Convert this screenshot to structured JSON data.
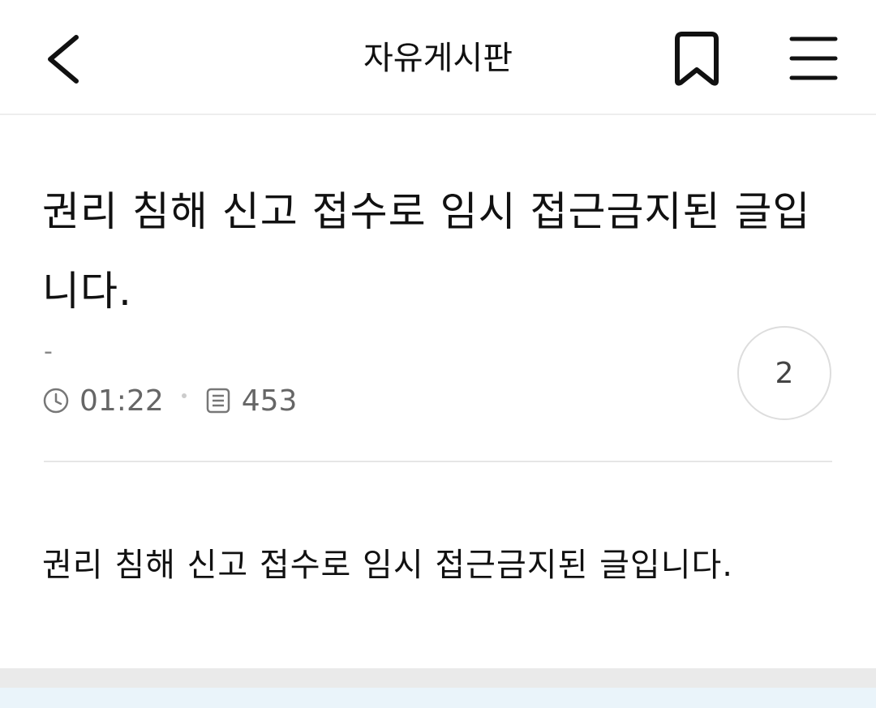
{
  "header": {
    "title": "자유게시판",
    "back_icon": "chevron-left-icon",
    "bookmark_icon": "bookmark-icon",
    "menu_icon": "hamburger-menu-icon"
  },
  "post": {
    "title": "권리 침해 신고 접수로 임시 접근금지된 글입니다.",
    "author": "-",
    "time": "01:22",
    "views": "453",
    "comment_count": "2",
    "body": "권리 침해 신고 접수로 임시 접근금지된 글입니다."
  },
  "colors": {
    "text": "#111111",
    "meta": "#666666",
    "divider": "#e6e6e6",
    "footer_band": "#eaf4fa"
  }
}
